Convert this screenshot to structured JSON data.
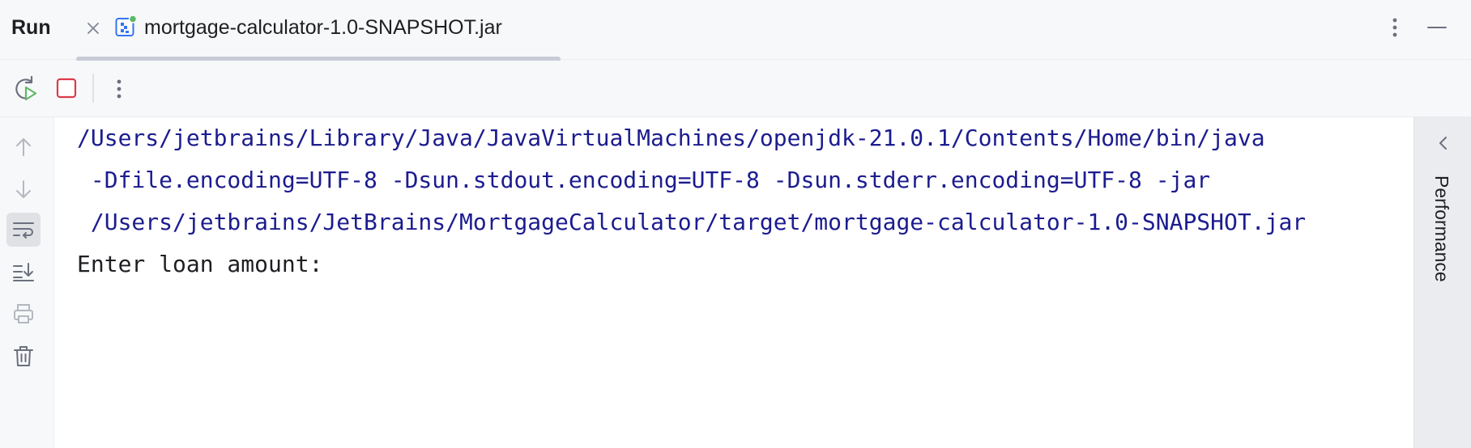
{
  "panel": {
    "title": "Run"
  },
  "tab": {
    "label": "mortgage-calculator-1.0-SNAPSHOT.jar",
    "icon": "jar-run-icon"
  },
  "toolbar": {
    "rerun_icon": "rerun-icon",
    "stop_icon": "stop-icon",
    "more_icon": "more-vertical-icon"
  },
  "gutter": {
    "items": [
      {
        "name": "up-arrow-icon"
      },
      {
        "name": "down-arrow-icon"
      },
      {
        "name": "soft-wrap-icon",
        "active": true
      },
      {
        "name": "scroll-to-end-icon"
      },
      {
        "name": "print-icon"
      },
      {
        "name": "trash-icon"
      }
    ]
  },
  "console": {
    "lines": [
      {
        "text": "/Users/jetbrains/Library/Java/JavaVirtualMachines/openjdk-21.0.1/Contents/Home/bin/java",
        "kind": "command"
      },
      {
        "text": " -Dfile.encoding=UTF-8 -Dsun.stdout.encoding=UTF-8 -Dsun.stderr.encoding=UTF-8 -jar",
        "kind": "command"
      },
      {
        "text": " /Users/jetbrains/JetBrains/MortgageCalculator/target/mortgage-calculator-1.0-SNAPSHOT.jar",
        "kind": "command"
      },
      {
        "text": "Enter loan amount: ",
        "kind": "output"
      }
    ]
  },
  "right_strip": {
    "label": "Performance"
  },
  "colors": {
    "command_text": "#1c1c8f",
    "output_text": "#1e1f22",
    "stop_red": "#db3b4b",
    "rerun_green": "#5fb865"
  }
}
